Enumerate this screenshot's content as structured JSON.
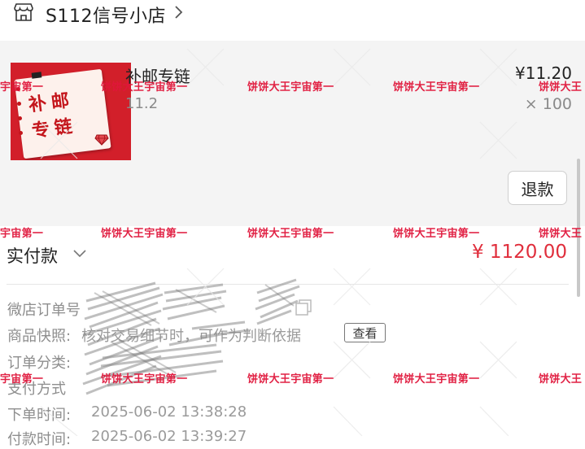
{
  "shop": {
    "name": "S112信号小店"
  },
  "product": {
    "title": "补邮专链",
    "spec": "11.2",
    "price": "¥11.20",
    "quantity": "× 100",
    "thumbnail_text_line1": "补邮",
    "thumbnail_text_line2": "专链"
  },
  "actions": {
    "refund_label": "退款",
    "view_label": "查看"
  },
  "payment": {
    "label": "实付款",
    "amount": "¥ 1120.00"
  },
  "order_info": {
    "order_no_label": "微店订单号",
    "snapshot_label": "商品快照:",
    "snapshot_value": "核对交易细节时，可作为判断依据",
    "category_label": "订单分类:",
    "pay_method_label": "支付方式",
    "order_time_label": "下单时间:",
    "order_time_value": "2025-06-02 13:38:28",
    "pay_time_label": "付款时间:",
    "pay_time_value": "2025-06-02 13:39:27"
  },
  "watermark": {
    "text": "饼饼大王宇宙第一",
    "partial_left": "宇宙第一",
    "partial_right": "饼饼大王"
  },
  "colors": {
    "accent_red": "#e02e3c",
    "watermark_red": "#e0163a",
    "thumb_red": "#d21f2a"
  }
}
